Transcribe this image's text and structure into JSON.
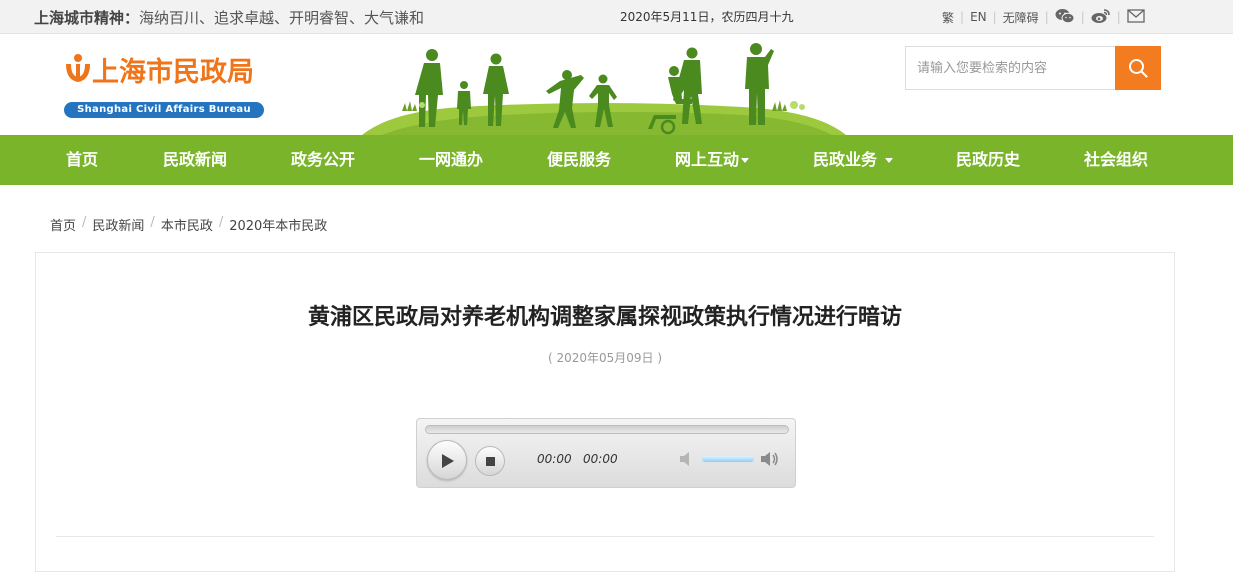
{
  "topbar": {
    "motto_label": "上海城市精神：",
    "motto_text": "海纳百川、追求卓越、开明睿智、大气谦和",
    "date": "2020年5月11日，农历四月十九",
    "links": {
      "traditional": "繁",
      "english": "EN",
      "accessibility": "无障碍"
    },
    "icons": [
      "wechat-icon",
      "weibo-icon",
      "mail-icon"
    ]
  },
  "header": {
    "logo_cn": "上海市民政局",
    "logo_en": "Shanghai Civil Affairs Bureau",
    "search": {
      "placeholder": "请输入您要检索的内容",
      "value": ""
    }
  },
  "nav": {
    "items": [
      {
        "label": "首页"
      },
      {
        "label": "民政新闻"
      },
      {
        "label": "政务公开"
      },
      {
        "label": "一网通办"
      },
      {
        "label": "便民服务"
      },
      {
        "label": "网上互动",
        "dropdown": true
      },
      {
        "label": "民政业务",
        "dropdown": true
      },
      {
        "label": "民政历史"
      },
      {
        "label": "社会组织"
      }
    ]
  },
  "breadcrumb": [
    "首页",
    "民政新闻",
    "本市民政",
    "2020年本市民政"
  ],
  "article": {
    "title": "黄浦区民政局对养老机构调整家属探视政策执行情况进行暗访",
    "date": "( 2020年05月09日 )"
  },
  "player": {
    "current_time": "00:00",
    "duration": "00:00",
    "progress": 0,
    "volume": 0.9
  },
  "colors": {
    "brand_orange": "#f0751a",
    "nav_green": "#7ab42a",
    "logo_blue": "#2474c0",
    "search_orange": "#f47c20"
  }
}
